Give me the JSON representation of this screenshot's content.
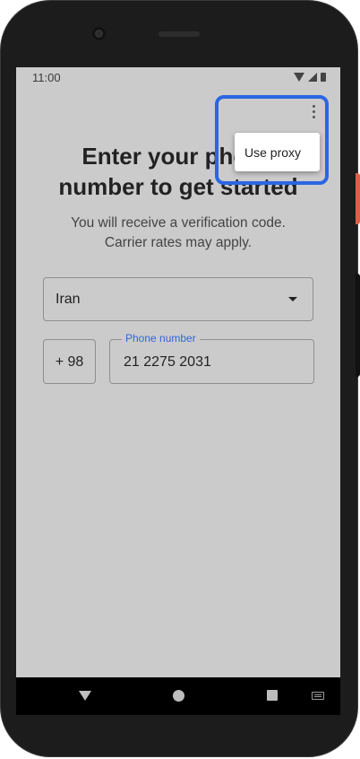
{
  "status_bar": {
    "time": "11:00"
  },
  "header": {
    "title_line1": "Enter your phone",
    "title_line2": "number to get started",
    "subtitle_line1": "You will receive a verification code.",
    "subtitle_line2": "Carrier rates may apply."
  },
  "form": {
    "country": "Iran",
    "country_code": "+ 98",
    "phone_label": "Phone number",
    "phone_value": "21 2275 2031"
  },
  "overflow_menu": {
    "items": [
      {
        "label": "Use proxy"
      }
    ]
  },
  "icons": {
    "overflow": "more-vert-icon",
    "dropdown": "arrow-drop-down-icon",
    "wifi": "wifi-icon",
    "signal": "cell-signal-icon",
    "battery": "battery-icon",
    "back": "back-icon",
    "home": "home-icon",
    "recents": "recents-icon",
    "keyboard": "keyboard-icon"
  },
  "colors": {
    "screen_bg": "#cbcbcb",
    "accent": "#3367d6",
    "highlight": "#2b66e3"
  }
}
